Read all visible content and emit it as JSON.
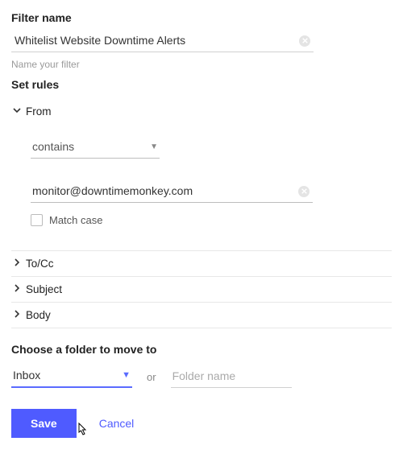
{
  "filterName": {
    "label": "Filter name",
    "value": "Whitelist Website Downtime Alerts",
    "hint": "Name your filter"
  },
  "setRules": {
    "label": "Set rules",
    "from": {
      "label": "From",
      "condition": "contains",
      "value": "monitor@downtimemonkey.com",
      "matchCaseLabel": "Match case"
    },
    "tocc": {
      "label": "To/Cc"
    },
    "subject": {
      "label": "Subject"
    },
    "body": {
      "label": "Body"
    }
  },
  "folder": {
    "label": "Choose a folder to move to",
    "selected": "Inbox",
    "or": "or",
    "placeholder": "Folder name"
  },
  "buttons": {
    "save": "Save",
    "cancel": "Cancel"
  }
}
